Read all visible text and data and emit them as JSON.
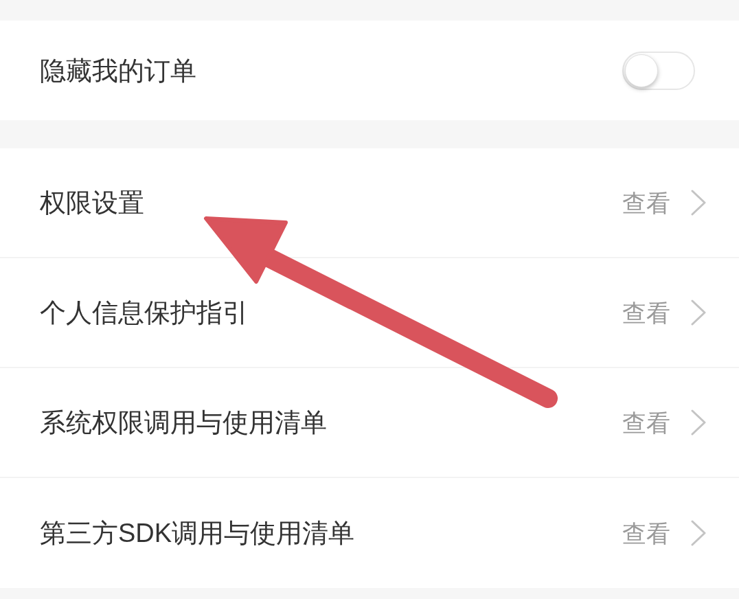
{
  "sections": [
    {
      "rows": [
        {
          "kind": "toggle",
          "label": "隐藏我的订单",
          "on": false
        }
      ]
    },
    {
      "rows": [
        {
          "kind": "link",
          "label": "权限设置",
          "action": "查看"
        },
        {
          "kind": "link",
          "label": "个人信息保护指引",
          "action": "查看"
        },
        {
          "kind": "link",
          "label": "系统权限调用与使用清单",
          "action": "查看"
        },
        {
          "kind": "link",
          "label": "第三方SDK调用与使用清单",
          "action": "查看"
        }
      ]
    }
  ]
}
